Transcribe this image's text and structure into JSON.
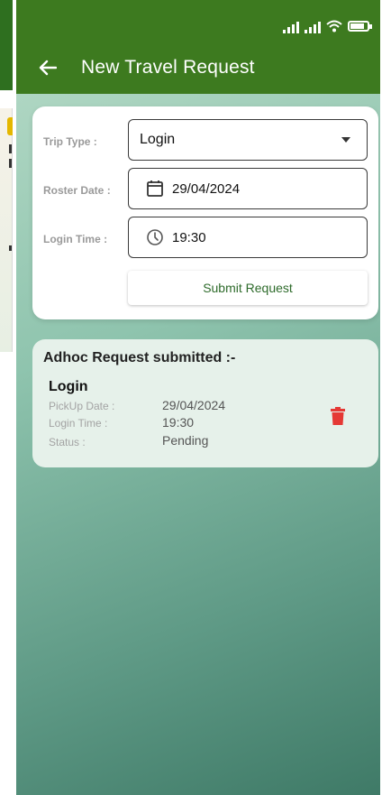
{
  "app": {
    "title": "New Travel Request"
  },
  "form": {
    "trip_type_label": "Trip Type :",
    "trip_type_value": "Login",
    "roster_date_label": "Roster Date :",
    "roster_date_value": "29/04/2024",
    "login_time_label": "Login Time :",
    "login_time_value": "19:30",
    "submit_label": "Submit Request"
  },
  "submitted": {
    "heading": "Adhoc Request submitted :-",
    "trip": "Login",
    "pickup_label": "PickUp Date :",
    "pickup_value": "29/04/2024",
    "login_time_label": "Login Time :",
    "login_time_value": "19:30",
    "status_label": "Status :",
    "status_value": "Pending"
  },
  "icons": {
    "back": "arrow-left-icon",
    "calendar": "calendar-icon",
    "clock": "clock-icon",
    "delete": "trash-icon",
    "dropdown": "caret-down-icon"
  },
  "colors": {
    "appbar": "#3d7a1f",
    "accent": "#2e6b2b",
    "delete": "#e53935",
    "card": "#ffffff",
    "submitted_card": "#e6f1ea"
  }
}
